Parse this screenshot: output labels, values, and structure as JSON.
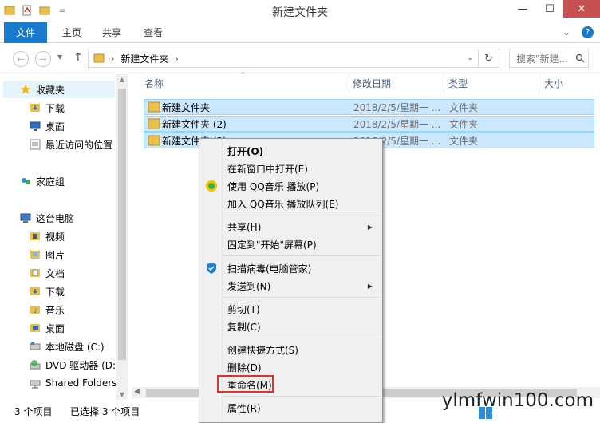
{
  "window": {
    "title": "新建文件夹",
    "qat_separator": "=",
    "minimize_label": "—",
    "maximize_label": "☐",
    "close_label": "✕"
  },
  "ribbon": {
    "tabs": [
      "文件",
      "主页",
      "共享",
      "查看"
    ],
    "expand_icon": "chevron-down-icon",
    "help_label": "?"
  },
  "navigation": {
    "back_icon": "back-arrow-icon",
    "forward_icon": "forward-arrow-icon",
    "up_icon": "up-arrow-icon",
    "address_path": "新建文件夹",
    "search_placeholder": "搜索\"新建...",
    "search_icon": "search-icon",
    "refresh_icon": "refresh-icon"
  },
  "sidebar": {
    "favorites_label": "收藏夹",
    "favorites": [
      "下载",
      "桌面",
      "最近访问的位置"
    ],
    "homegroup_label": "家庭组",
    "thispc_label": "这台电脑",
    "thispc_items": [
      "视频",
      "图片",
      "文档",
      "下载",
      "音乐",
      "桌面",
      "本地磁盘 (C:)",
      "DVD 驱动器 (D:)",
      "Shared Folders"
    ]
  },
  "columns": {
    "name": "名称",
    "date": "修改日期",
    "type": "类型",
    "size": "大小"
  },
  "files": [
    {
      "name": "新建文件夹",
      "date": "2018/2/5/星期一 ...",
      "type": "文件夹"
    },
    {
      "name": "新建文件夹 (2)",
      "date": "2018/2/5/星期一 ...",
      "type": "文件夹"
    },
    {
      "name": "新建文件夹 (3)",
      "date": "2018/2/5/星期一 ...",
      "type": "文件夹"
    }
  ],
  "status": {
    "item_count": "3 个项目",
    "selected_count": "已选择 3 个项目"
  },
  "context_menu": {
    "open": "打开(O)",
    "open_new_window": "在新窗口中打开(E)",
    "qq_play": "使用 QQ音乐 播放(P)",
    "qq_queue": "加入 QQ音乐 播放队列(E)",
    "share": "共享(H)",
    "pin_start": "固定到\"开始\"屏幕(P)",
    "scan": "扫描病毒(电脑管家)",
    "send_to": "发送到(N)",
    "cut": "剪切(T)",
    "copy": "复制(C)",
    "create_shortcut": "创建快捷方式(S)",
    "delete": "删除(D)",
    "rename": "重命名(M)",
    "properties": "属性(R)"
  },
  "watermark": "ylmfwin100.com",
  "colors": {
    "accent": "#1979ca",
    "selection": "#cce8ff",
    "highlight_box": "#e03030",
    "folder": "#e8c04a"
  }
}
